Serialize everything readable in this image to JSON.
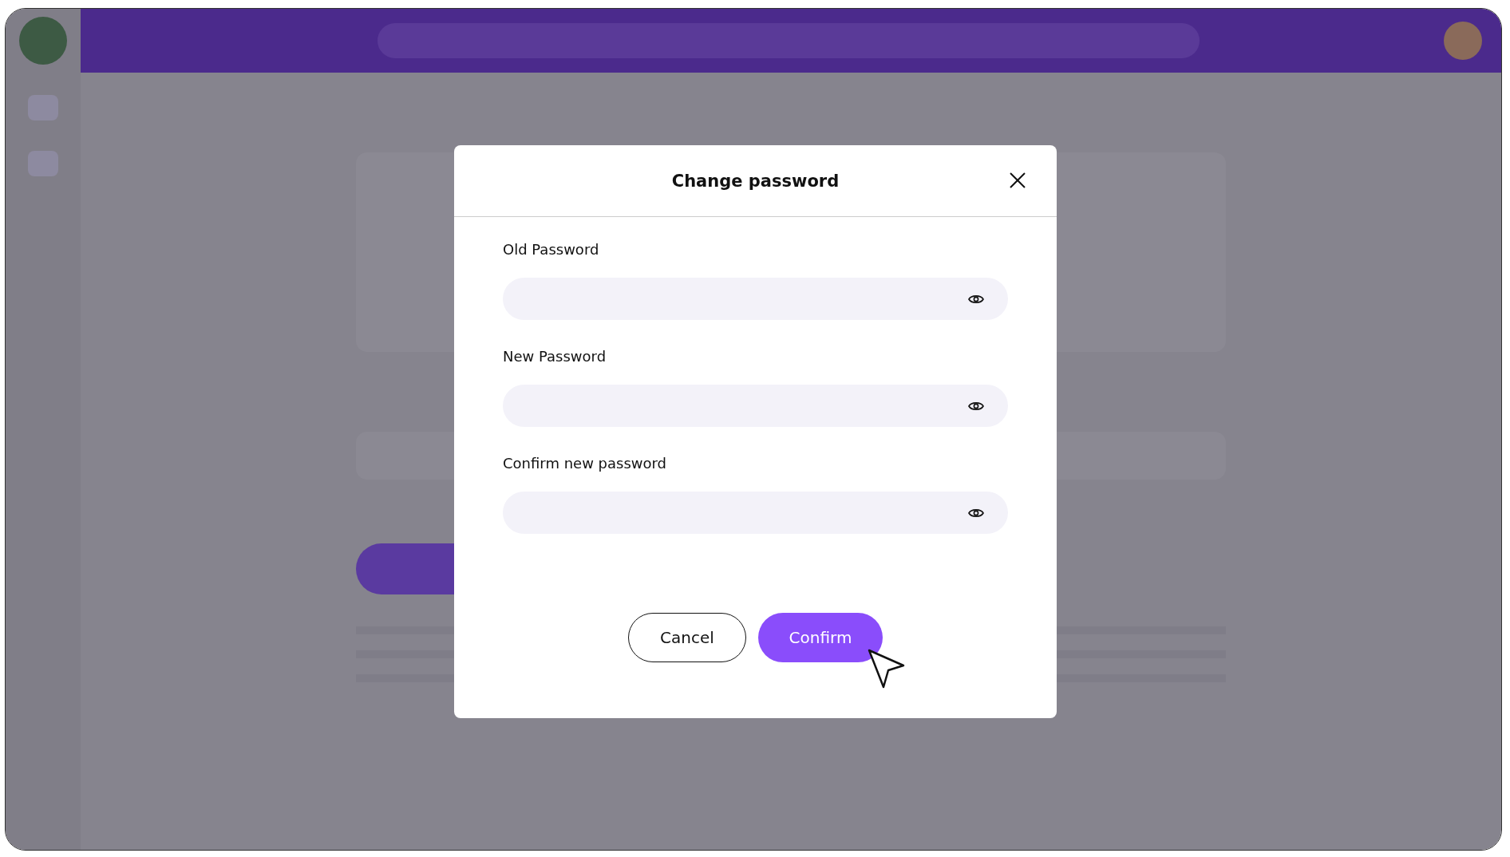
{
  "dialog": {
    "title": "Change password",
    "fields": [
      {
        "label": "Old Password"
      },
      {
        "label": "New Password"
      },
      {
        "label": "Confirm new password"
      }
    ],
    "buttons": [
      {
        "label": "Cancel",
        "kind": "secondary"
      },
      {
        "label": "Confirm",
        "kind": "primary"
      }
    ]
  }
}
